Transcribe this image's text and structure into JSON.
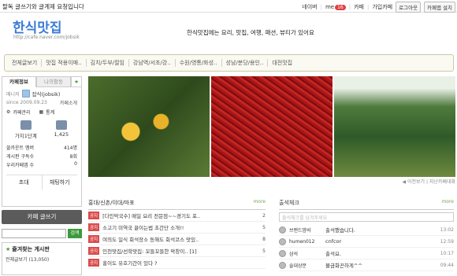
{
  "topbar": {
    "notice": "팔독 글쓰기와 글계제 요청입니다",
    "links": [
      "네이버",
      "me",
      "카페",
      "가입카페",
      "로그아웃",
      "카페앱 설치"
    ],
    "me_badge": "16"
  },
  "header": {
    "title": "한식맛집",
    "url": "http://cafe.naver.com/jobsik",
    "description": "한식맛집에는 요리, 맛집, 여행, 패션, 뷰티가 있어요"
  },
  "menu": [
    "전체글보기",
    "맛집 적용이매..",
    "김치/두부/절임",
    "강남역/서초/강..",
    "수원/영통/화성..",
    "성남/분당/용인..",
    "대전맛집"
  ],
  "sidebar": {
    "tabs": [
      "카페정보",
      "나의활동"
    ],
    "manager_label": "매니저",
    "manager": "잡식(jobsik)",
    "since": "since 2009.09.23",
    "cafe_intro": "카페소개",
    "cafe_manage": "카페관리",
    "stats_label": "통계",
    "level": "가지1단계",
    "members": "1,425",
    "rows": [
      {
        "label": "쓸카운트 멤버",
        "value": "414명"
      },
      {
        "label": "게시판 구독수",
        "value": "8회"
      },
      {
        "label": "우리카페앱 수",
        "value": "0"
      }
    ],
    "btn_invite": "초대",
    "btn_chat": "채팅하기",
    "write_label": "카페 글쓰기",
    "search_btn": "검색",
    "fav_title": "즐겨찾는 게시판",
    "fav_item": "전체글보기 (13,050)"
  },
  "photo_controls": "◀ 이전보기 | 지난카페대화",
  "board": {
    "title": "홍대/신촌/이대/마포",
    "more": "more",
    "tag": "공지",
    "rows": [
      {
        "title": "[다인막국수] 매일 요리 전문점~~경기도 포..",
        "count": "2"
      },
      {
        "title": "소고기 미역국 끓이는법 초간단 소개!!",
        "count": "5"
      },
      {
        "title": "여의도 일식 회석장소 동해도 회석코스 맛있..",
        "count": "8"
      },
      {
        "title": "인천맛집/선학맛집: 꼬들꼬들한 막창이.. [1]",
        "count": "5"
      },
      {
        "title": "홍이도 유호기간이 있다 ?",
        "count": ""
      }
    ]
  },
  "attend": {
    "title": "출석체크",
    "more": "more",
    "placeholder": "출석체크를 남겨주세요",
    "rows": [
      {
        "user": "브랜드밤바",
        "msg": "출석했습니다.",
        "time": "13:02"
      },
      {
        "user": "humen012",
        "msg": "cnfcor",
        "time": "12:59"
      },
      {
        "user": "삼석",
        "msg": "출석요.",
        "time": "10:17"
      },
      {
        "user": "솔대상분",
        "msg": "불금화끈하게^^",
        "time": "09:44"
      }
    ]
  }
}
